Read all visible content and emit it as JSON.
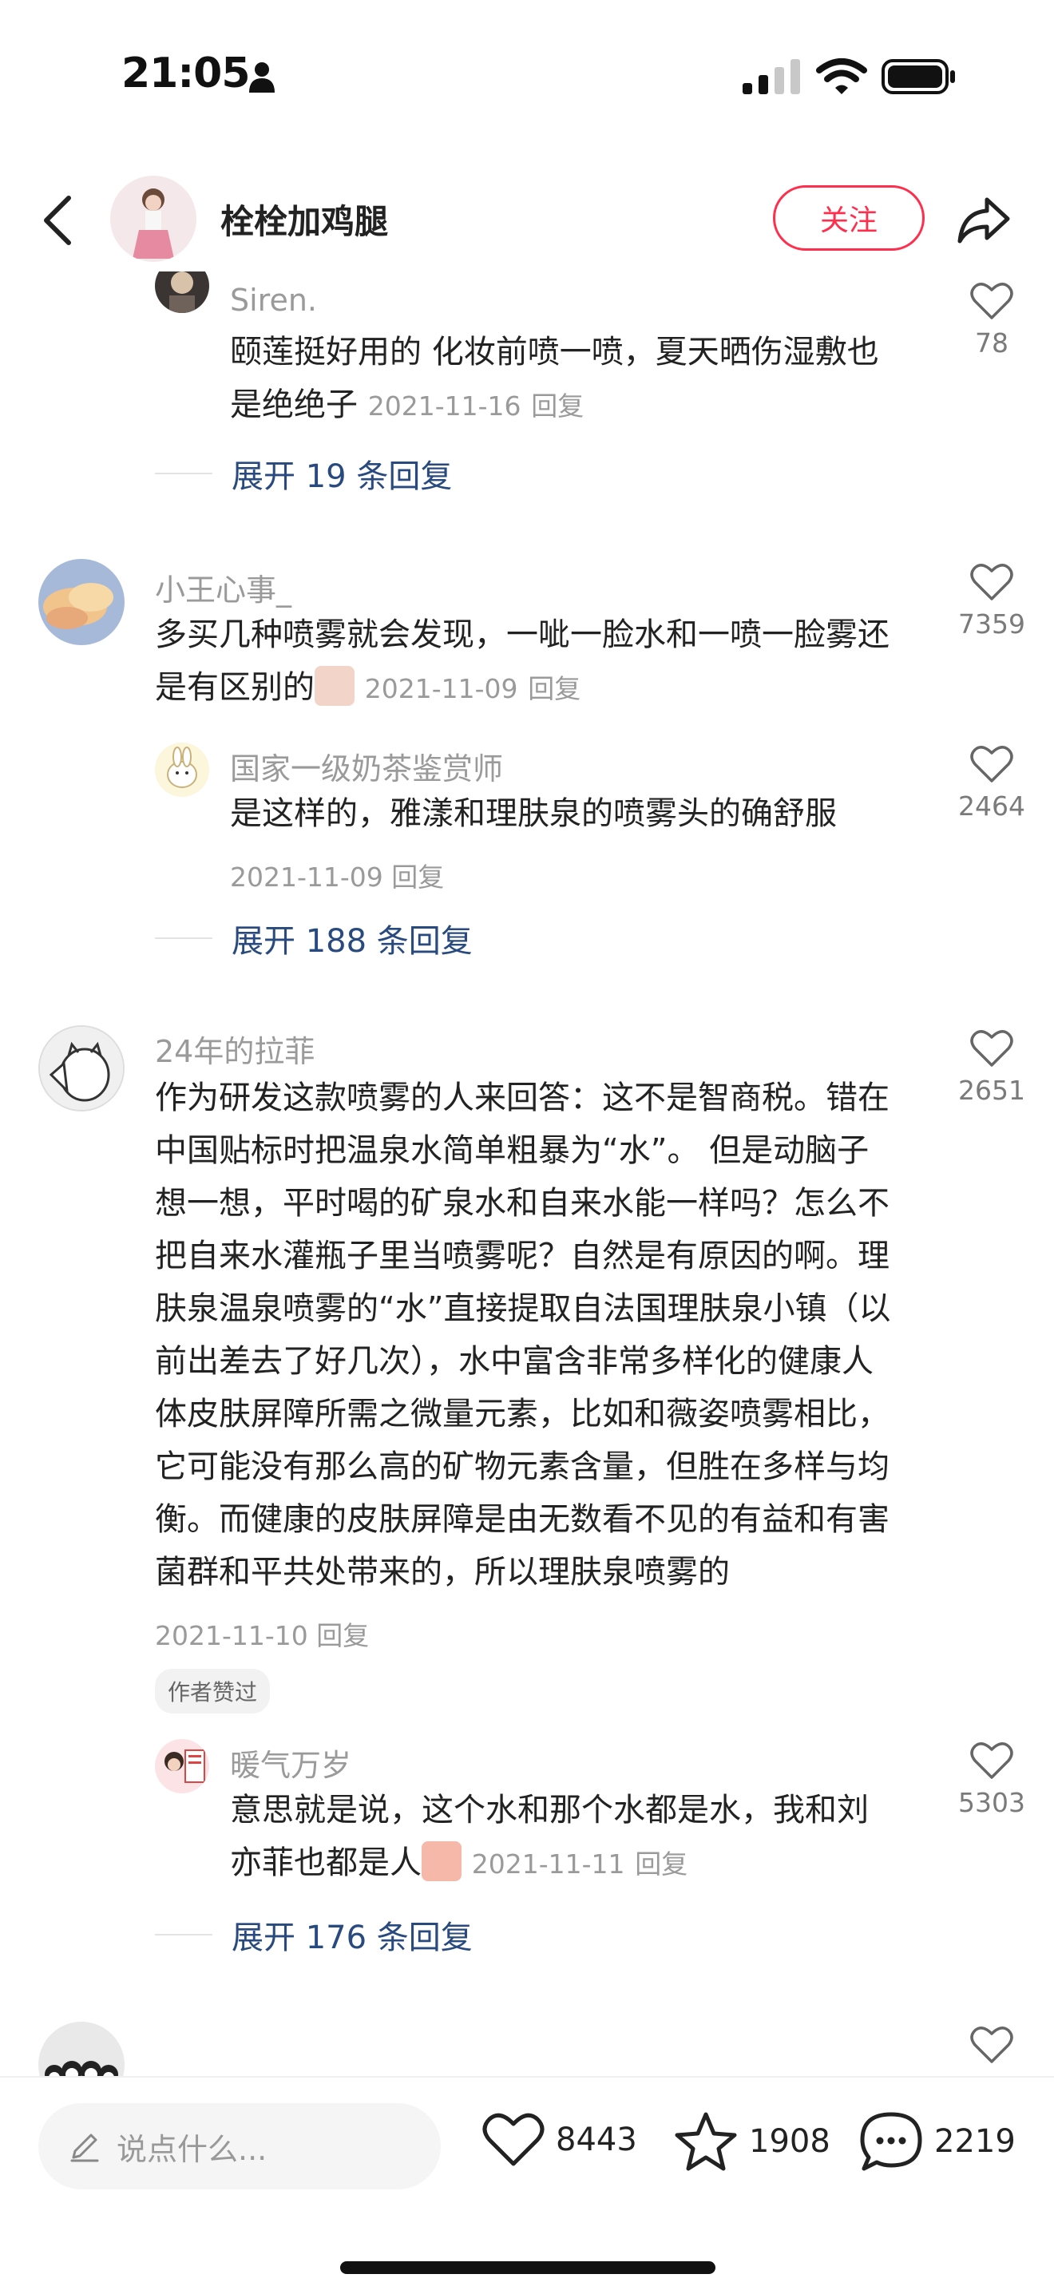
{
  "status_bar": {
    "time": "21:05"
  },
  "header": {
    "author_name": "栓栓加鸡腿",
    "follow_label": "关注"
  },
  "comments": [
    {
      "user": "Siren.",
      "lines": [
        "颐莲挺好用的  化妆前喷一喷，夏天晒伤湿敷也",
        "是绝绝子"
      ],
      "date": "2021-11-16",
      "reply_label": "回复",
      "likes": "78",
      "expand": "展开 19 条回复"
    },
    {
      "user": "小王心事_",
      "lines": [
        "多买几种喷雾就会发现，一呲一脸水和一喷一脸雾还",
        "是有区别的"
      ],
      "date": "2021-11-09",
      "reply_label": "回复",
      "likes": "7359",
      "reply": {
        "user": "国家一级奶茶鉴赏师",
        "lines": [
          "是这样的，雅漾和理肤泉的喷雾头的确舒服"
        ],
        "date": "2021-11-09",
        "reply_label": "回复",
        "likes": "2464"
      },
      "expand": "展开 188 条回复"
    },
    {
      "user": "24年的拉菲",
      "lines": [
        "作为研发这款喷雾的人来回答：这不是智商税。错在",
        "中国贴标时把温泉水简单粗暴为“水”。 但是动脑子",
        "想一想，平时喝的矿泉水和自来水能一样吗？怎么不",
        "把自来水灌瓶子里当喷雾呢？自然是有原因的啊。理",
        "肤泉温泉喷雾的“水”直接提取自法国理肤泉小镇（以",
        "前出差去了好几次），水中富含非常多样化的健康人",
        "体皮肤屏障所需之微量元素，比如和薇姿喷雾相比，",
        "它可能没有那么高的矿物元素含量，但胜在多样与均",
        "衡。而健康的皮肤屏障是由无数看不见的有益和有害",
        "菌群和平共处带来的，所以理肤泉喷雾的"
      ],
      "date": "2021-11-10",
      "reply_label": "回复",
      "likes": "2651",
      "author_badge": "作者赞过",
      "reply": {
        "user": "暖气万岁",
        "lines": [
          "意思就是说，这个水和那个水都是水，我和刘",
          "亦菲也都是人"
        ],
        "date": "2021-11-11",
        "reply_label": "回复",
        "likes": "5303"
      },
      "expand": "展开 176 条回复"
    }
  ],
  "bottom_bar": {
    "input_placeholder": "说点什么...",
    "like_count": "8443",
    "collect_count": "1908",
    "comment_count": "2219"
  },
  "colors": {
    "accent": "#ff2e4d",
    "link": "#284a7e",
    "muted": "#9a9a9a"
  }
}
